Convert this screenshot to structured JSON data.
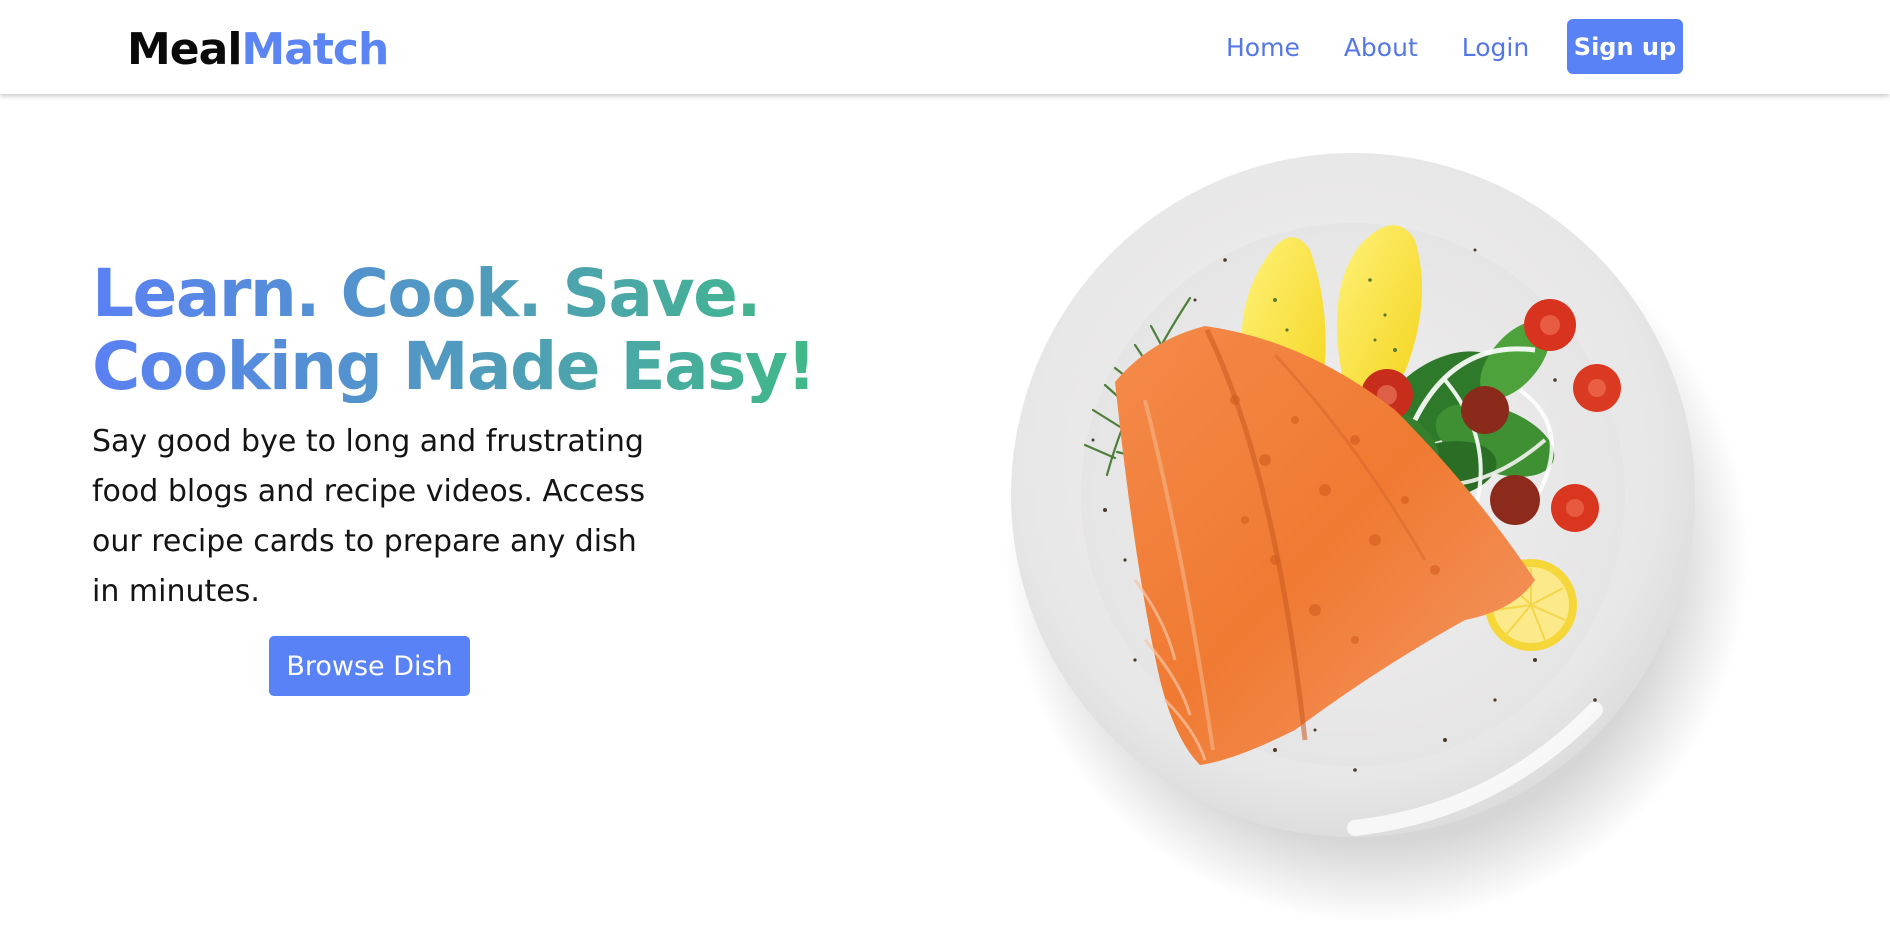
{
  "brand": {
    "part1": "Meal",
    "part2": "Match"
  },
  "nav": {
    "links": [
      {
        "label": "Home"
      },
      {
        "label": "About"
      },
      {
        "label": "Login"
      }
    ],
    "signup_label": "Sign up"
  },
  "hero": {
    "headline_line1": "Learn. Cook. Save.",
    "headline_line2": "Cooking Made Easy!",
    "subtext": "Say good bye to long and frustrating food blogs and recipe videos. Access our recipe cards to prepare any dish in minutes.",
    "cta_label": "Browse Dish"
  },
  "colors": {
    "accent": "#5882f6",
    "nav_link": "#5577e4",
    "gradient_start": "#5a80f4",
    "gradient_end": "#3ebc82"
  },
  "image": {
    "subject": "salmon-plate"
  }
}
